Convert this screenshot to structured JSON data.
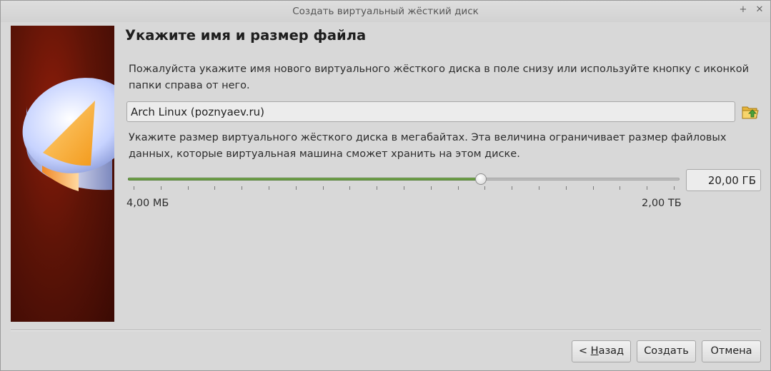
{
  "window": {
    "title": "Создать виртуальный жёсткий диск",
    "maximize_glyph": "+",
    "close_glyph": "✕"
  },
  "page": {
    "heading": "Укажите имя и размер файла",
    "name_description": "Пожалуйста укажите имя нового виртуального жёсткого диска в поле снизу или используйте кнопку с иконкой папки справа от него.",
    "size_description": "Укажите размер виртуального жёсткого диска в мегабайтах. Эта величина ограничивает размер файловых данных, которые виртуальная машина сможет хранить на этом диске."
  },
  "name_input": {
    "value": "Arch Linux (poznyaev.ru)"
  },
  "folder_button": {
    "icon": "folder-open-icon"
  },
  "size_slider": {
    "min_label": "4,00 МБ",
    "max_label": "2,00 ТБ",
    "fraction": 0.643,
    "tick_count": 20
  },
  "size_field": {
    "value": "20,00 ГБ"
  },
  "buttons": {
    "back_prefix": "< ",
    "back_mnemonic": "Н",
    "back_rest": "азад",
    "create": "Создать",
    "cancel": "Отмена"
  },
  "colors": {
    "slider_fill": "#6a9c45",
    "side_image_bg": "#5e1407"
  }
}
